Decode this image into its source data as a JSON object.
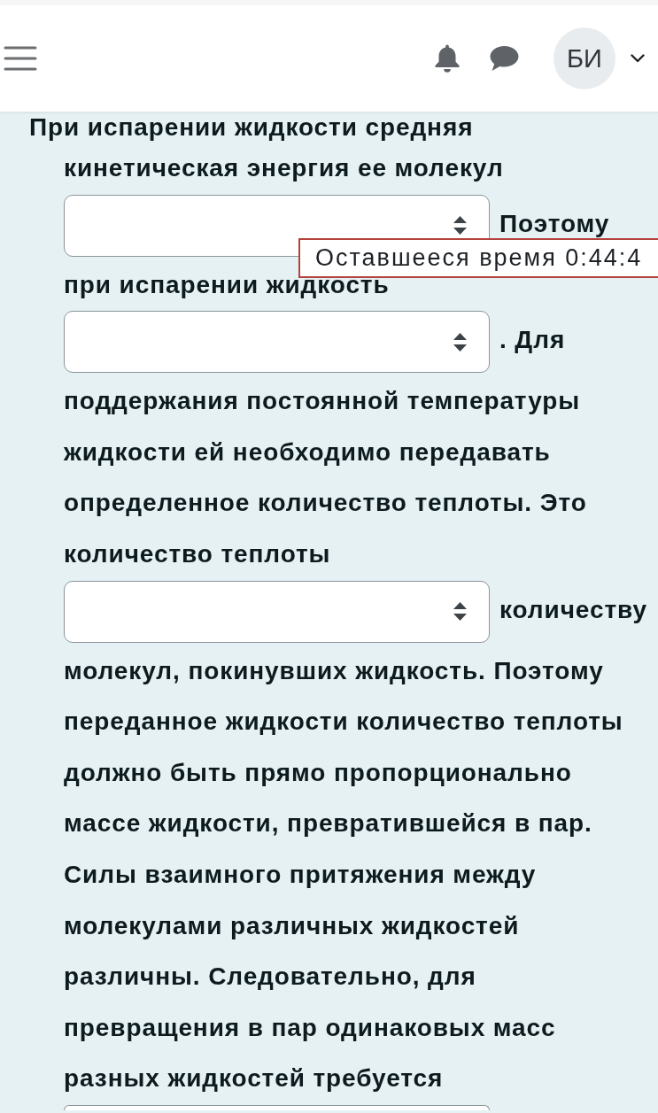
{
  "header": {
    "avatar_initials": "БИ"
  },
  "question": {
    "cut_line": "При испарении жидкости средняя",
    "items": [
      {
        "kind": "line",
        "text": "кинетическая энергия ее молекул"
      },
      {
        "kind": "select",
        "after": "Поэтому"
      },
      {
        "kind": "line",
        "text": "при испарении жидкость"
      },
      {
        "kind": "select",
        "after": ". Для"
      },
      {
        "kind": "line",
        "text": "поддержания постоянной температуры"
      },
      {
        "kind": "line",
        "text": "жидкости ей необходимо передавать"
      },
      {
        "kind": "line",
        "text": "определенное количество теплоты. Это"
      },
      {
        "kind": "line",
        "text": "количество теплоты"
      },
      {
        "kind": "select",
        "after": "количеству"
      },
      {
        "kind": "line",
        "text": "молекул, покинувших жидкость. Поэтому"
      },
      {
        "kind": "line",
        "text": "переданное жидкости количество теплоты"
      },
      {
        "kind": "line",
        "text": "должно быть прямо пропорционально"
      },
      {
        "kind": "line",
        "text": "массе жидкости, превратившейся в пар."
      },
      {
        "kind": "line",
        "text": "Силы взаимного притяжения между"
      },
      {
        "kind": "line",
        "text": "молекулами различных жидкостей"
      },
      {
        "kind": "line",
        "text": "различны. Следовательно, для"
      },
      {
        "kind": "line",
        "text": "превращения в пар одинаковых масс"
      },
      {
        "kind": "line",
        "text": "разных жидкостей требуется"
      },
      {
        "kind": "select"
      }
    ]
  },
  "timer": {
    "text": "Оставшееся время 0:44:4"
  }
}
